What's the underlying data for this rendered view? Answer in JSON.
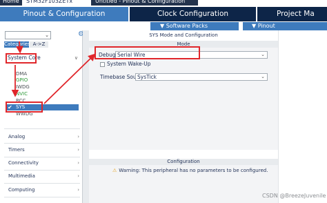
{
  "breadcrumb": {
    "home": "Home",
    "device": "STM32F103ZETx",
    "project": "Untitled - Pinout & Configuration"
  },
  "tabs": [
    {
      "label": "Pinout & Configuration",
      "active": true
    },
    {
      "label": "Clock Configuration",
      "active": false
    },
    {
      "label": "Project Ma",
      "active": false
    }
  ],
  "subbar": {
    "software_packs": "Software Packs",
    "pinout": "Pinout",
    "chevron": "chevron-down-icon"
  },
  "left_panel": {
    "search": {
      "value": "",
      "dropdown_icon": "chevron-down-icon"
    },
    "settings_icon": "gear-icon",
    "category_tabs": [
      "Categories",
      "A->Z"
    ],
    "expanded_category": "System Core",
    "system_core_items": [
      {
        "label": "DMA",
        "state": "normal"
      },
      {
        "label": "GPIO",
        "state": "ok"
      },
      {
        "label": "IWDG",
        "state": "normal"
      },
      {
        "label": "NVIC",
        "state": "ok"
      },
      {
        "label": "RCC",
        "state": "normal"
      },
      {
        "label": "SYS",
        "state": "selected"
      },
      {
        "label": "WWDG",
        "state": "normal"
      }
    ],
    "groups": [
      "Analog",
      "Timers",
      "Connectivity",
      "Multimedia",
      "Computing"
    ]
  },
  "right_panel": {
    "title": "SYS Mode and Configuration",
    "mode_header": "Mode",
    "debug_label": "Debug",
    "debug_value": "Serial Wire",
    "wakeup_label": "System Wake-Up",
    "wakeup_checked": false,
    "timebase_label": "Timebase Source",
    "timebase_value": "SysTick",
    "config_header": "Configuration",
    "warning_text": "Warning: This peripheral has no parameters to be configured."
  },
  "watermark": "CSDN @BreezeJuvenile",
  "colors": {
    "accent_blue": "#3e7bbd",
    "navy": "#0d2548",
    "annotation_red": "#e0262b",
    "ok_green": "#2f9a3b",
    "warning_yellow": "#e7a21b"
  }
}
